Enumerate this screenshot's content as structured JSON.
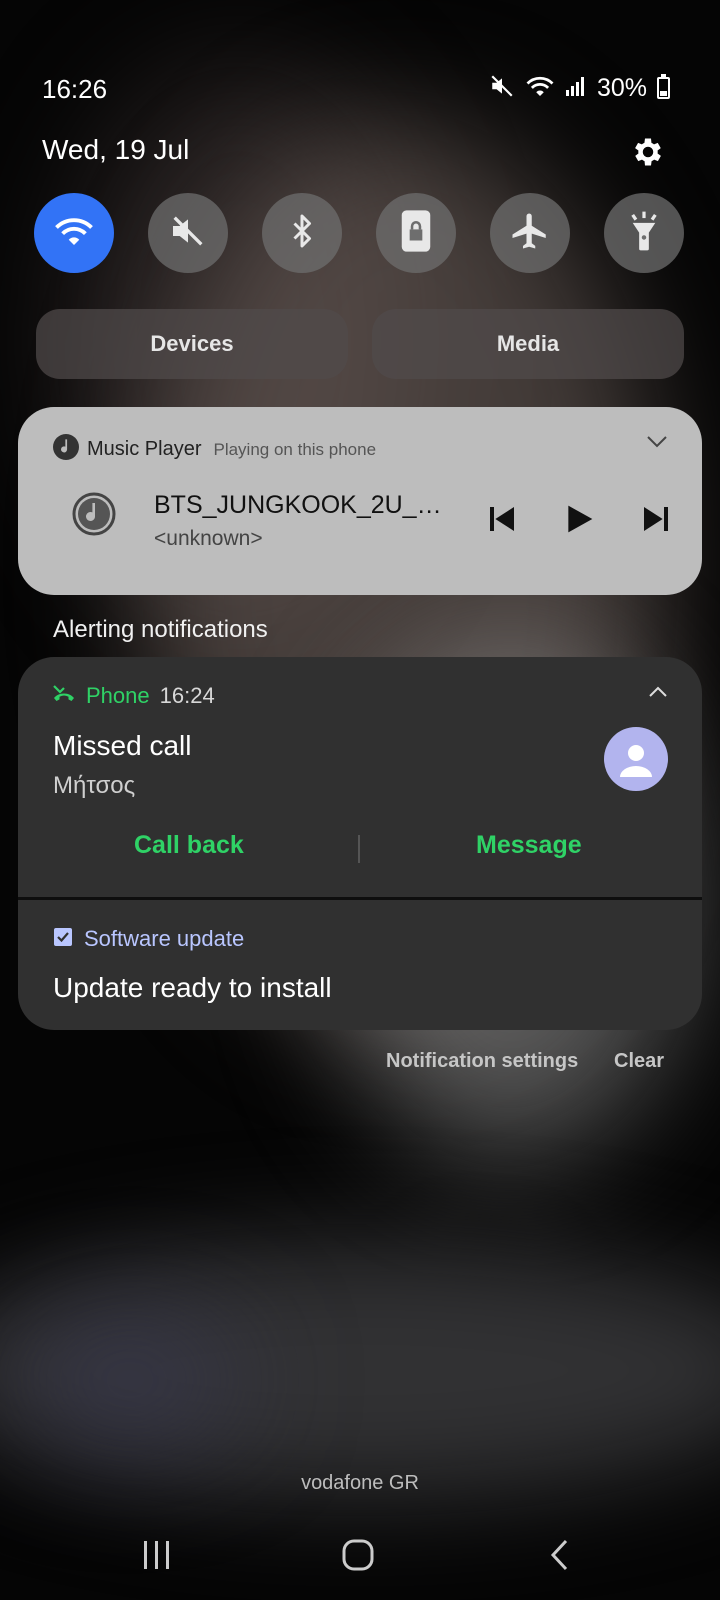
{
  "status_bar": {
    "time": "16:26",
    "battery_percent": "30%",
    "icons": [
      "mute-icon",
      "wifi-icon",
      "signal-icon",
      "battery-icon"
    ]
  },
  "header": {
    "date": "Wed, 19 Jul",
    "settings_icon": "gear-icon"
  },
  "quick_settings": [
    {
      "name": "wifi",
      "icon": "wifi-icon",
      "active": true
    },
    {
      "name": "sound",
      "icon": "mute-icon",
      "active": false
    },
    {
      "name": "bluetooth",
      "icon": "bluetooth-icon",
      "active": false
    },
    {
      "name": "rotation-lock",
      "icon": "lock-icon",
      "active": false
    },
    {
      "name": "airplane-mode",
      "icon": "airplane-icon",
      "active": false
    },
    {
      "name": "flashlight",
      "icon": "flashlight-icon",
      "active": false
    }
  ],
  "panels": {
    "devices_label": "Devices",
    "media_label": "Media"
  },
  "music_player": {
    "app_name": "Music Player",
    "subtitle": "Playing on this phone",
    "song_title": "BTS_JUNGKOOK_2U_Co...",
    "artist": "<unknown>",
    "playing": false
  },
  "notifications": {
    "section_label": "Alerting notifications",
    "phone": {
      "app_name": "Phone",
      "time": "16:24",
      "title": "Missed call",
      "caller": "Μήτσος",
      "actions": {
        "call_back": "Call back",
        "message": "Message"
      }
    },
    "software_update": {
      "app_name": "Software update",
      "body": "Update ready to install"
    },
    "footer": {
      "settings_label": "Notification settings",
      "clear_label": "Clear"
    }
  },
  "carrier": "vodafone GR",
  "colors": {
    "accent_blue": "#3273f6",
    "phone_green": "#2fd266",
    "music_card": "#bdbdbd",
    "notification_card": "#303030",
    "software_update_blue": "#b9c6ff"
  }
}
